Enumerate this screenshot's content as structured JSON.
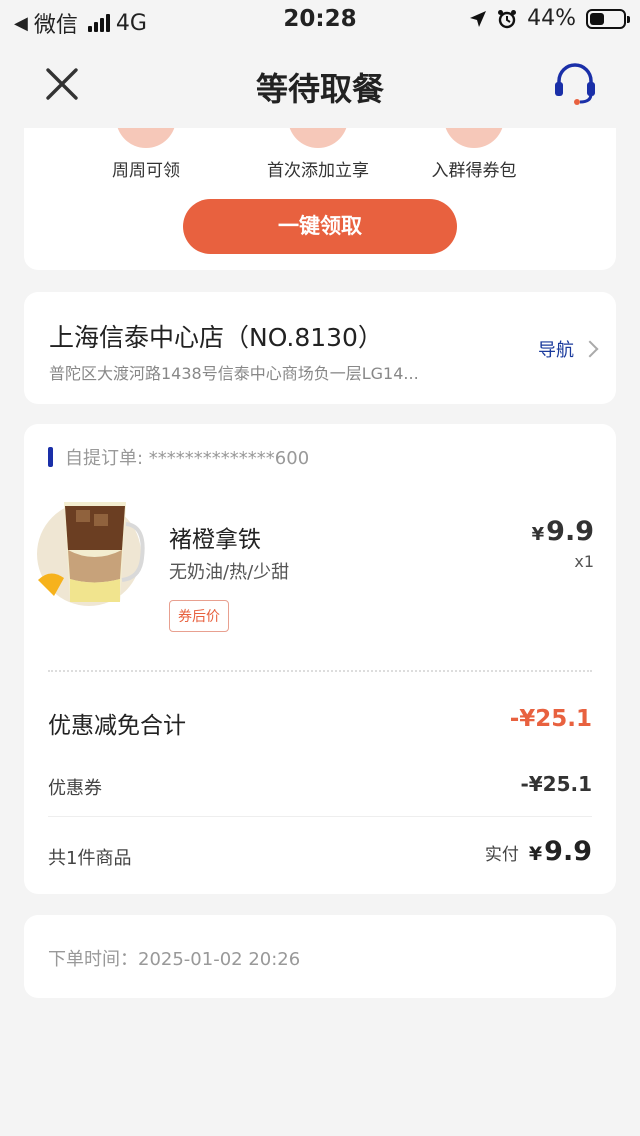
{
  "status_bar": {
    "back_app": "微信",
    "network": "4G",
    "time": "20:28",
    "battery": "44%",
    "battery_level": 0.44
  },
  "nav": {
    "title": "等待取餐"
  },
  "perks": {
    "items": [
      "周周可领",
      "首次添加立享",
      "入群得券包"
    ],
    "claim_button": "一键领取"
  },
  "store": {
    "name": "上海信泰中心店（NO.8130）",
    "address": "普陀区大渡河路1438号信泰中心商场负一层LG14...",
    "nav_label": "导航"
  },
  "order": {
    "header": "自提订单: **************600",
    "item": {
      "name": "褚橙拿铁",
      "options": "无奶油/热/少甜",
      "tag": "券后价",
      "price_symbol": "¥",
      "price": "9.9",
      "qty": "x1"
    },
    "discount_title": "优惠减免合计",
    "discount_total": "-¥25.1",
    "coupon_label": "优惠券",
    "coupon_value": "-¥25.1",
    "count_label": "共1件商品",
    "paid_label": "实付",
    "paid_symbol": "¥",
    "paid_value": "9.9"
  },
  "order_time": "下单时间：2025-01-02 20:26",
  "colors": {
    "accent": "#e8613f",
    "brand_blue": "#1a3a9c",
    "background": "#f4f4f4"
  }
}
